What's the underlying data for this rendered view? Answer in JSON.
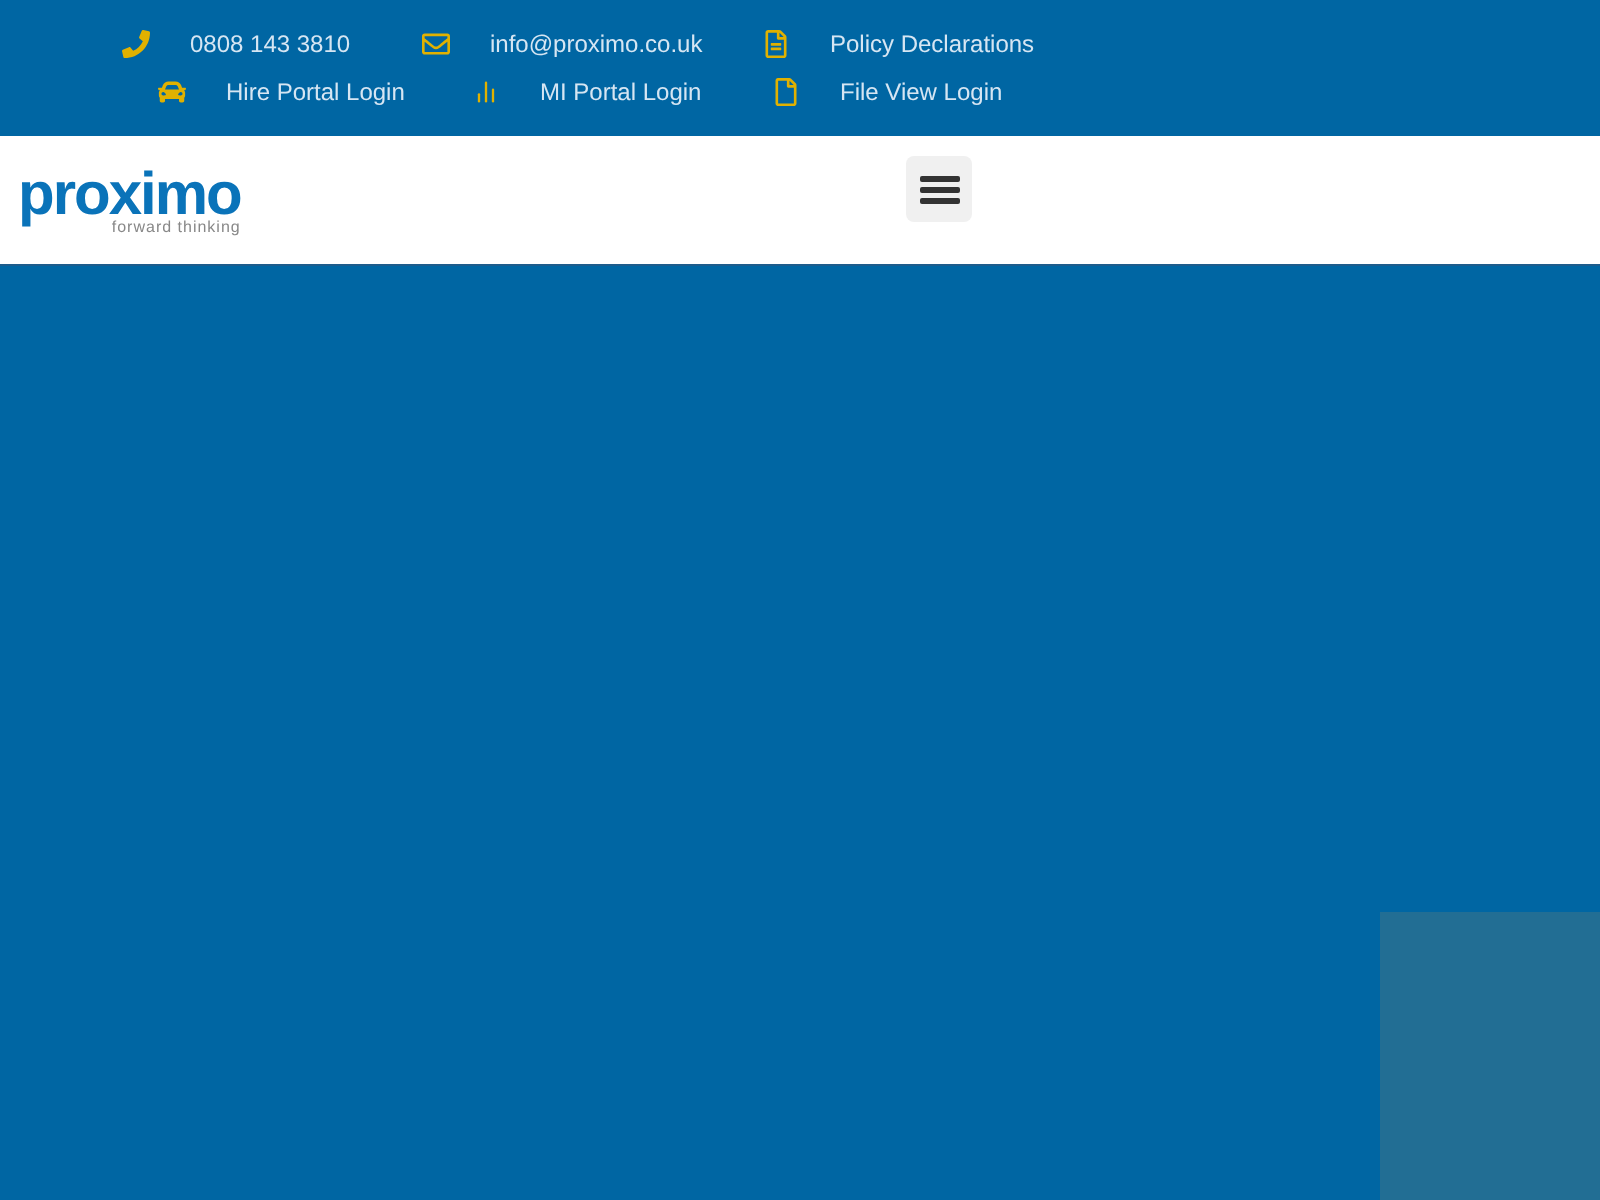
{
  "top_bar": {
    "rows": [
      [
        {
          "kind": "phone",
          "label": "0808 143 3810"
        },
        {
          "kind": "mail",
          "label": "info@proximo.co.uk"
        },
        {
          "kind": "document",
          "label": "Policy Declarations"
        }
      ],
      [
        {
          "kind": "car",
          "label": "Hire Portal Login"
        },
        {
          "kind": "chart",
          "label": "MI Portal Login"
        },
        {
          "kind": "file",
          "label": "File View Login"
        }
      ]
    ]
  },
  "header": {
    "logo": {
      "name": "proximo",
      "tagline": "forward thinking"
    }
  }
}
